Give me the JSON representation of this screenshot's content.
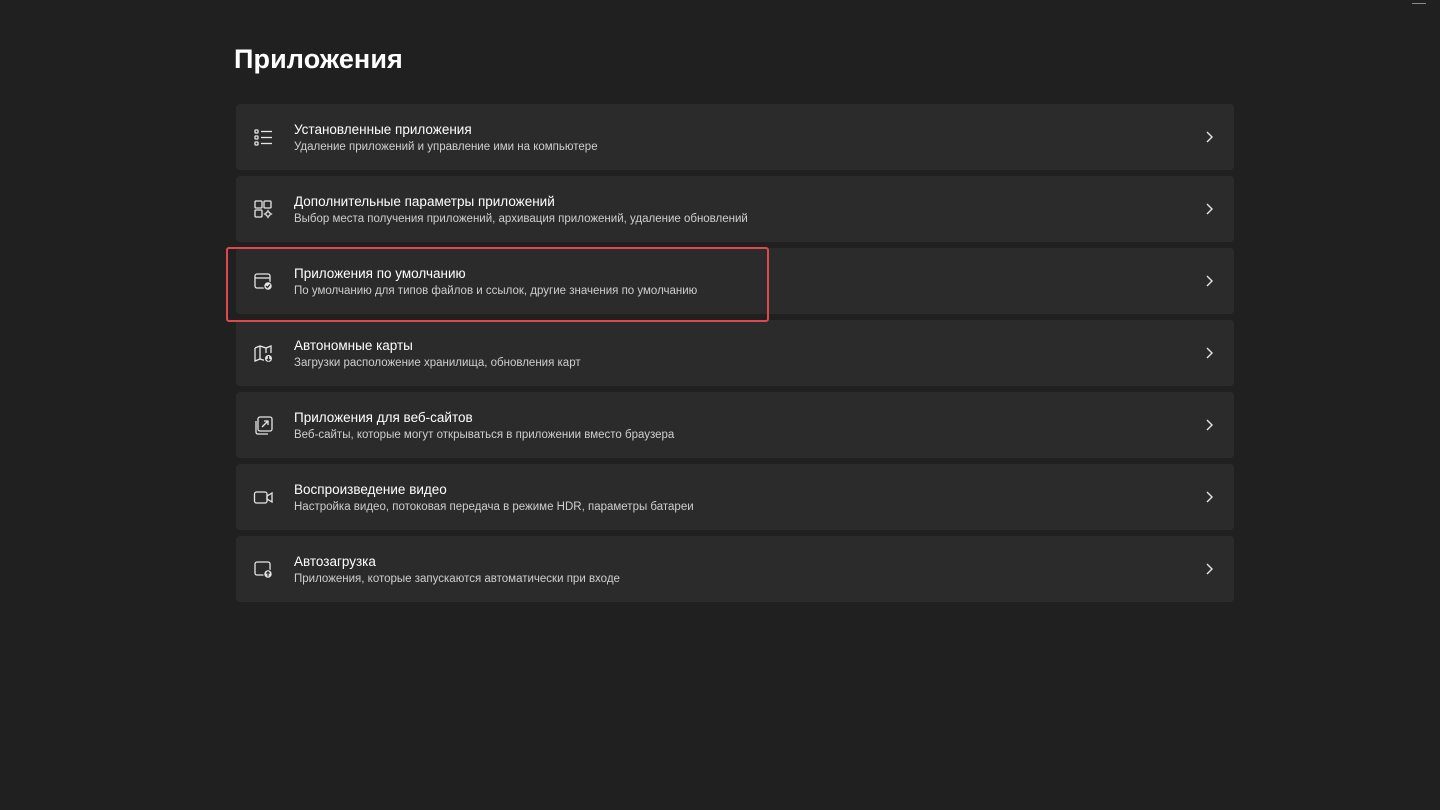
{
  "page": {
    "title": "Приложения"
  },
  "colors": {
    "background": "#202020",
    "card": "#2b2b2b",
    "highlight": "#e0484f"
  },
  "items": [
    {
      "title": "Установленные приложения",
      "subtitle": "Удаление приложений и управление ими на компьютере",
      "icon": "list-icon"
    },
    {
      "title": "Дополнительные параметры приложений",
      "subtitle": "Выбор места получения приложений, архивация приложений, удаление обновлений",
      "icon": "apps-settings-icon"
    },
    {
      "title": "Приложения по умолчанию",
      "subtitle": "По умолчанию для типов файлов и ссылок, другие значения по умолчанию",
      "icon": "default-apps-icon"
    },
    {
      "title": "Автономные карты",
      "subtitle": "Загрузки расположение хранилища, обновления карт",
      "icon": "offline-maps-icon"
    },
    {
      "title": "Приложения для веб-сайтов",
      "subtitle": "Веб-сайты, которые могут открываться в приложении вместо браузера",
      "icon": "open-in-app-icon"
    },
    {
      "title": "Воспроизведение видео",
      "subtitle": "Настройка видео, потоковая передача в режиме HDR, параметры батареи",
      "icon": "video-camera-icon"
    },
    {
      "title": "Автозагрузка",
      "subtitle": "Приложения, которые запускаются автоматически при входе",
      "icon": "startup-icon"
    }
  ],
  "highlighted_item": "Приложения по умолчанию"
}
